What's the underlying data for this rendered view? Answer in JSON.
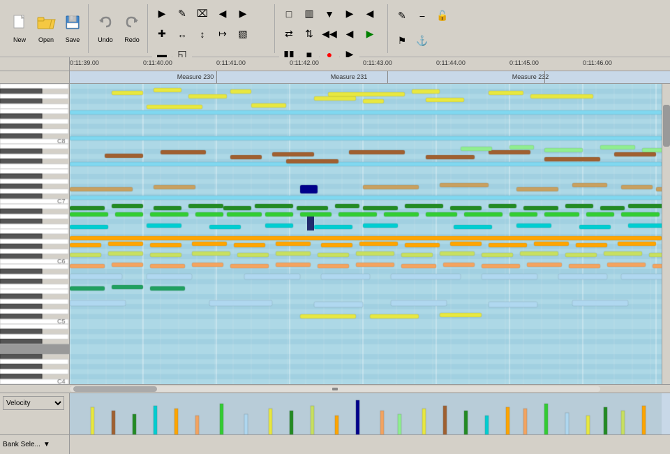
{
  "toolbar": {
    "new_label": "New",
    "open_label": "Open",
    "save_label": "Save",
    "undo_label": "Undo",
    "redo_label": "Redo"
  },
  "timeline": {
    "times": [
      "0:11:39.00",
      "0:11:40.00",
      "0:11:41.00",
      "0:11:42.00",
      "0:11:43.00",
      "0:11:44.00",
      "0:11:45.00",
      "0:11:46.00"
    ],
    "measures": [
      "Measure 230",
      "Measure 231",
      "Measure 232"
    ]
  },
  "piano": {
    "labels": [
      "C6",
      "C5",
      "C4"
    ]
  },
  "velocity": {
    "label": "Velocity",
    "bank_label": "Bank Sele..."
  }
}
